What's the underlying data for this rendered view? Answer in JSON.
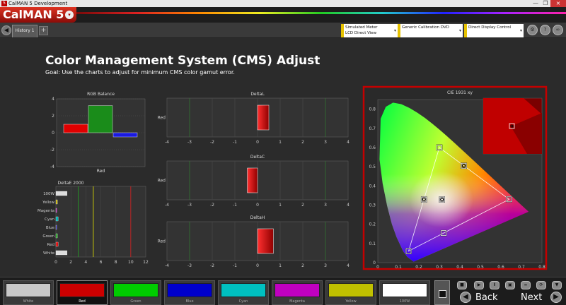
{
  "window": {
    "title": "CalMAN 5 Development"
  },
  "brand": {
    "name": "CalMAN 5"
  },
  "tabs": [
    {
      "label": "History 1"
    }
  ],
  "devices": [
    {
      "line1": "Simulated Meter",
      "line2": "LCD Direct View"
    },
    {
      "line1": "Generic Calibration DVD",
      "line2": ""
    },
    {
      "line1": "Direct Display Control",
      "line2": ""
    }
  ],
  "page": {
    "title": "Color Management System (CMS) Adjust",
    "goal": "Goal: Use the charts to adjust for minimum CMS color gamut error."
  },
  "chart_data": [
    {
      "type": "bar",
      "title": "RGB Balance",
      "xlabel": "Red",
      "categories": [
        "R",
        "G",
        "B"
      ],
      "values": [
        1.0,
        3.2,
        -0.5
      ],
      "colors": [
        "#e00000",
        "#1a8c1a",
        "#1a1ae0"
      ],
      "ylim": [
        -4,
        4
      ],
      "yticks": [
        -4,
        -2,
        0,
        2,
        4
      ]
    },
    {
      "type": "bar",
      "orientation": "horizontal",
      "title": "DeltaE 2000",
      "categories": [
        "100W",
        "Yellow",
        "Magenta",
        "Cyan",
        "Blue",
        "Green",
        "Red",
        "White"
      ],
      "values": [
        1.5,
        0.2,
        0.1,
        0.3,
        0.1,
        0.2,
        0.3,
        1.5
      ],
      "colors": [
        "#dddddd",
        "#c8b400",
        "#c800c8",
        "#00b4b4",
        "#2222dd",
        "#22aa22",
        "#dd1111",
        "#dddddd"
      ],
      "xlim": [
        0,
        12
      ],
      "xticks": [
        0,
        2,
        4,
        6,
        8,
        10,
        12
      ],
      "reference_lines": [
        {
          "x": 3,
          "color": "#22aa22"
        },
        {
          "x": 5,
          "color": "#e6e600"
        },
        {
          "x": 10,
          "color": "#dd2222"
        }
      ]
    },
    {
      "type": "bar",
      "orientation": "horizontal",
      "title": "DeltaL",
      "categories": [
        "Red"
      ],
      "values": [
        0.5
      ],
      "xlim": [
        -4,
        4
      ],
      "xticks": [
        -4,
        -3,
        -2,
        -1,
        0,
        1,
        2,
        3,
        4
      ]
    },
    {
      "type": "bar",
      "orientation": "horizontal",
      "title": "DeltaC",
      "categories": [
        "Red"
      ],
      "values": [
        -0.45
      ],
      "xlim": [
        -4,
        4
      ],
      "xticks": [
        -4,
        -3,
        -2,
        -1,
        0,
        1,
        2,
        3,
        4
      ]
    },
    {
      "type": "bar",
      "orientation": "horizontal",
      "title": "DeltaH",
      "categories": [
        "Red"
      ],
      "values": [
        0.7
      ],
      "xlim": [
        -4,
        4
      ],
      "xticks": [
        -4,
        -3,
        -2,
        -1,
        0,
        1,
        2,
        3,
        4
      ]
    },
    {
      "type": "scatter",
      "title": "CIE 1931 xy",
      "xlim": [
        0,
        0.8
      ],
      "ylim": [
        0,
        0.85
      ],
      "xticks": [
        0,
        0.1,
        0.2,
        0.3,
        0.4,
        0.5,
        0.6,
        0.7,
        0.8
      ],
      "yticks": [
        0,
        0.1,
        0.2,
        0.3,
        0.4,
        0.5,
        0.6,
        0.7,
        0.8
      ],
      "gamut": [
        [
          0.64,
          0.33
        ],
        [
          0.3,
          0.6
        ],
        [
          0.15,
          0.06
        ]
      ],
      "targets": [
        {
          "name": "Red",
          "x": 0.64,
          "y": 0.33
        },
        {
          "name": "Green",
          "x": 0.3,
          "y": 0.6
        },
        {
          "name": "Blue",
          "x": 0.15,
          "y": 0.06
        },
        {
          "name": "Cyan",
          "x": 0.225,
          "y": 0.329
        },
        {
          "name": "Magenta",
          "x": 0.321,
          "y": 0.154
        },
        {
          "name": "Yellow",
          "x": 0.419,
          "y": 0.505
        },
        {
          "name": "White",
          "x": 0.3127,
          "y": 0.329
        }
      ],
      "measured": [
        {
          "name": "Cyan",
          "x": 0.225,
          "y": 0.33
        },
        {
          "name": "Yellow",
          "x": 0.419,
          "y": 0.505
        },
        {
          "name": "White",
          "x": 0.3127,
          "y": 0.329
        }
      ]
    }
  ],
  "swatches": [
    {
      "label": "White",
      "color": "#c8c8c8"
    },
    {
      "label": "Red",
      "color": "#cc0000"
    },
    {
      "label": "Green",
      "color": "#00cc00"
    },
    {
      "label": "Blue",
      "color": "#0000cc"
    },
    {
      "label": "Cyan",
      "color": "#00c0c0"
    },
    {
      "label": "Magenta",
      "color": "#c000c0"
    },
    {
      "label": "Yellow",
      "color": "#c0c000"
    },
    {
      "label": "100W",
      "color": "#ffffff"
    }
  ],
  "selected_swatch": "Red",
  "nav": {
    "back": "Back",
    "next": "Next"
  },
  "icons": {
    "close": "×",
    "restore": "❐",
    "minimize": "—",
    "back_nav": "◀",
    "add_tab": "+",
    "dropdown": "▾",
    "settings": "⚙",
    "help": "?",
    "play": "▶",
    "pause": "Ⅱ",
    "save": "▣",
    "link": "∞",
    "refresh": "⟳",
    "down": "▼"
  }
}
